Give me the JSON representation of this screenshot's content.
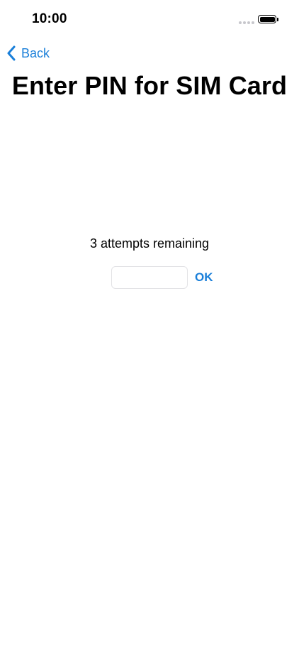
{
  "status_bar": {
    "time": "10:00",
    "battery_level": 1.0
  },
  "nav": {
    "back_label": "Back",
    "back_icon": "chevron-left-icon"
  },
  "page": {
    "title": "Enter PIN for SIM Card",
    "attempts_text": "3 attempts remaining"
  },
  "pin_field": {
    "value": "",
    "placeholder": ""
  },
  "actions": {
    "ok_label": "OK"
  },
  "colors": {
    "accent": "#1a7fd9",
    "text": "#000000",
    "background": "#ffffff",
    "field_border": "#e3e3e6"
  }
}
